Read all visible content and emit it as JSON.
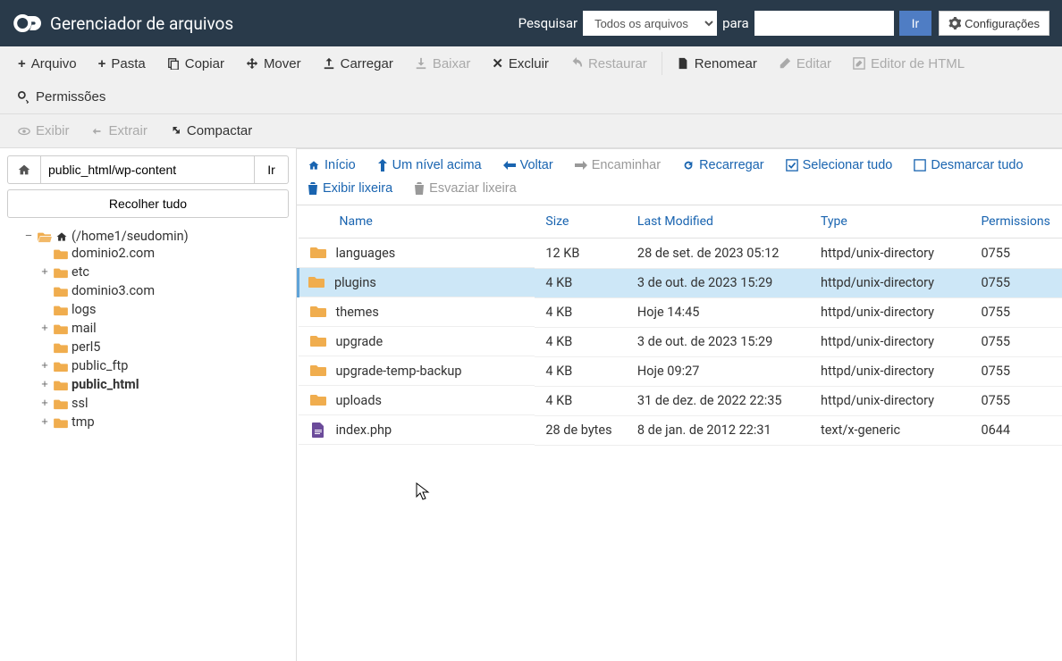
{
  "header": {
    "title": "Gerenciador de arquivos",
    "search_label": "Pesquisar",
    "search_scope_selected": "Todos os arquivos",
    "for_label": "para",
    "search_value": "",
    "go_label": "Ir",
    "config_label": "Configurações"
  },
  "toolbar": {
    "arquivo": "Arquivo",
    "pasta": "Pasta",
    "copiar": "Copiar",
    "mover": "Mover",
    "carregar": "Carregar",
    "baixar": "Baixar",
    "excluir": "Excluir",
    "restaurar": "Restaurar",
    "renomear": "Renomear",
    "editar": "Editar",
    "editor_html": "Editor de HTML",
    "permissoes": "Permissões",
    "exibir": "Exibir",
    "extrair": "Extrair",
    "compactar": "Compactar"
  },
  "left": {
    "path_value": "public_html/wp-content",
    "go_label": "Ir",
    "collapse_label": "Recolher tudo",
    "root_label": "(/home1/seudomin)",
    "tree": [
      {
        "label": "dominio2.com",
        "expandable": false
      },
      {
        "label": "etc",
        "expandable": true
      },
      {
        "label": "dominio3.com",
        "expandable": false
      },
      {
        "label": "logs",
        "expandable": false
      },
      {
        "label": "mail",
        "expandable": true
      },
      {
        "label": "perl5",
        "expandable": false
      },
      {
        "label": "public_ftp",
        "expandable": true
      },
      {
        "label": "public_html",
        "expandable": true,
        "bold": true
      },
      {
        "label": "ssl",
        "expandable": true
      },
      {
        "label": "tmp",
        "expandable": true
      }
    ]
  },
  "actionbar": {
    "inicio": "Início",
    "up": "Um nível acima",
    "voltar": "Voltar",
    "encaminhar": "Encaminhar",
    "recarregar": "Recarregar",
    "selecionar_tudo": "Selecionar tudo",
    "desmarcar_tudo": "Desmarcar tudo",
    "exibir_lixeira": "Exibir lixeira",
    "esvaziar_lixeira": "Esvaziar lixeira"
  },
  "table": {
    "headers": {
      "name": "Name",
      "size": "Size",
      "modified": "Last Modified",
      "type": "Type",
      "permissions": "Permissions"
    },
    "rows": [
      {
        "icon": "folder",
        "name": "languages",
        "size": "12 KB",
        "modified": "28 de set. de 2023 05:12",
        "type": "httpd/unix-directory",
        "perm": "0755",
        "selected": false
      },
      {
        "icon": "folder",
        "name": "plugins",
        "size": "4 KB",
        "modified": "3 de out. de 2023 15:29",
        "type": "httpd/unix-directory",
        "perm": "0755",
        "selected": true
      },
      {
        "icon": "folder",
        "name": "themes",
        "size": "4 KB",
        "modified": "Hoje 14:45",
        "type": "httpd/unix-directory",
        "perm": "0755",
        "selected": false
      },
      {
        "icon": "folder",
        "name": "upgrade",
        "size": "4 KB",
        "modified": "3 de out. de 2023 15:29",
        "type": "httpd/unix-directory",
        "perm": "0755",
        "selected": false
      },
      {
        "icon": "folder",
        "name": "upgrade-temp-backup",
        "size": "4 KB",
        "modified": "Hoje 09:27",
        "type": "httpd/unix-directory",
        "perm": "0755",
        "selected": false
      },
      {
        "icon": "folder",
        "name": "uploads",
        "size": "4 KB",
        "modified": "31 de dez. de 2022 22:35",
        "type": "httpd/unix-directory",
        "perm": "0755",
        "selected": false
      },
      {
        "icon": "file",
        "name": "index.php",
        "size": "28 de bytes",
        "modified": "8 de jan. de 2012 22:31",
        "type": "text/x-generic",
        "perm": "0644",
        "selected": false
      }
    ]
  }
}
